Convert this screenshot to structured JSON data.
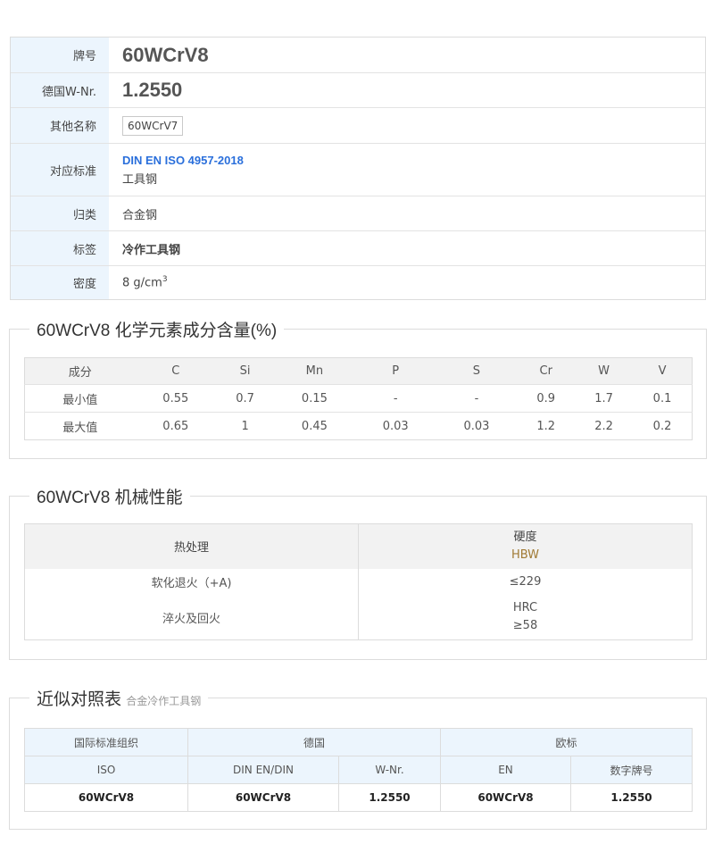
{
  "info": {
    "grade_label": "牌号",
    "grade_value": "60WCrV8",
    "wnr_label": "德国W-Nr.",
    "wnr_value": "1.2550",
    "other_label": "其他名称",
    "other_value": "60WCrV7",
    "std_label": "对应标准",
    "std_link": "DIN EN ISO 4957-2018",
    "std_sub": "工具钢",
    "category_label": "归类",
    "category_value": "合金钢",
    "tag_label": "标签",
    "tag_value": "冷作工具钢",
    "density_label": "密度",
    "density_value": "8 g/cm",
    "density_sup": "3"
  },
  "chemistry": {
    "title": "60WCrV8 化学元素成分含量(%)",
    "headers": [
      "成分",
      "C",
      "Si",
      "Mn",
      "P",
      "S",
      "Cr",
      "W",
      "V"
    ],
    "rows": [
      [
        "最小值",
        "0.55",
        "0.7",
        "0.15",
        "-",
        "-",
        "0.9",
        "1.7",
        "0.1"
      ],
      [
        "最大值",
        "0.65",
        "1",
        "0.45",
        "0.03",
        "0.03",
        "1.2",
        "2.2",
        "0.2"
      ]
    ]
  },
  "mechanical": {
    "title": "60WCrV8 机械性能",
    "col1_header": "热处理",
    "col2_header": "硬度",
    "col2_unit": "HBW",
    "row1_treatment": "软化退火（+A)",
    "row1_value": "≤229",
    "row2_treatment": "淬火及回火",
    "row2_value_1": "HRC",
    "row2_value_2": "≥58"
  },
  "comparison": {
    "title": "近似对照表",
    "subtitle": "合金冷作工具钢",
    "group_headers": [
      "国际标准组织",
      "德国",
      "欧标"
    ],
    "sub_headers": [
      "ISO",
      "DIN EN/DIN",
      "W-Nr.",
      "EN",
      "数字牌号"
    ],
    "row": [
      "60WCrV8",
      "60WCrV8",
      "1.2550",
      "60WCrV8",
      "1.2550"
    ]
  }
}
